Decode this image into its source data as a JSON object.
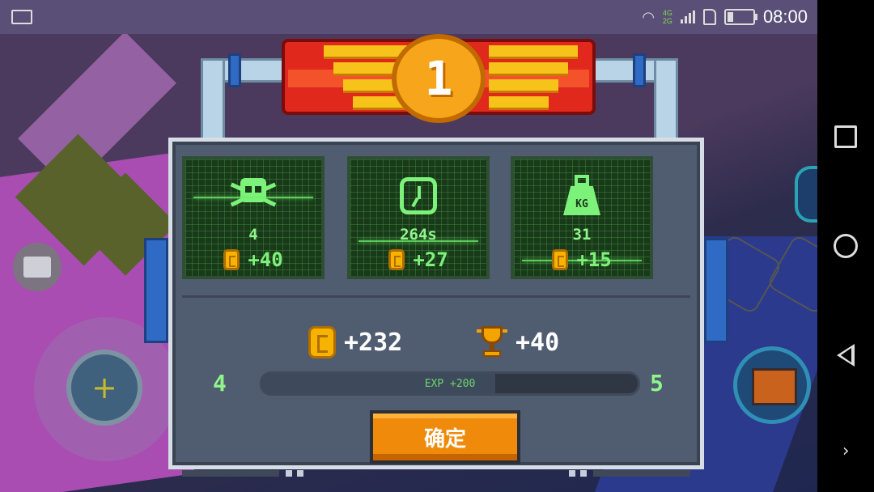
{
  "status_bar": {
    "network_top": "4G",
    "network_bottom": "2G",
    "time": "08:00"
  },
  "rank": {
    "value": "1"
  },
  "stats": [
    {
      "icon": "skull-icon",
      "value": "4",
      "reward": "+40"
    },
    {
      "icon": "clock-icon",
      "value": "264s",
      "reward": "+27"
    },
    {
      "icon": "weight-icon",
      "value": "31",
      "reward": "+15",
      "icon_text": "KG"
    }
  ],
  "totals": {
    "coins": "+232",
    "trophies": "+40"
  },
  "level": {
    "current": "4",
    "next": "5",
    "exp_label": "EXP +200",
    "exp_progress": 0.62
  },
  "confirm_button": "确定",
  "colors": {
    "screen_green": "#7df27a",
    "confirm_orange": "#f08a0a",
    "banner_red": "#e0281c",
    "coin_gold": "#f6b400"
  }
}
